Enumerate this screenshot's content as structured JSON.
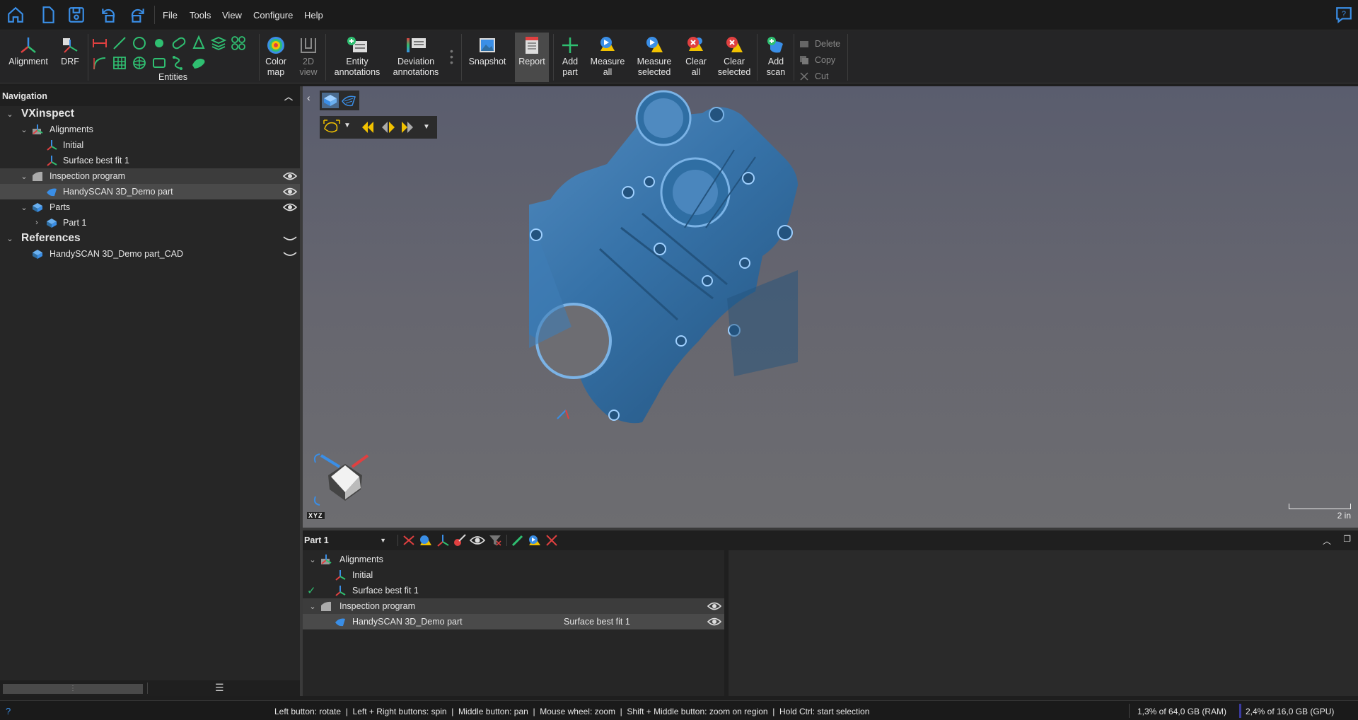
{
  "menubar": {
    "items": [
      "File",
      "Tools",
      "View",
      "Configure",
      "Help"
    ]
  },
  "ribbon": {
    "alignment": "Alignment",
    "drf": "DRF",
    "entities": "Entities",
    "color_map": [
      "Color",
      "map"
    ],
    "view_2d": [
      "2D",
      "view"
    ],
    "entity_annotations": [
      "Entity",
      "annotations"
    ],
    "deviation_annotations": [
      "Deviation",
      "annotations"
    ],
    "snapshot": "Snapshot",
    "report": "Report",
    "add_part": [
      "Add",
      "part"
    ],
    "measure_all": [
      "Measure",
      "all"
    ],
    "measure_selected": [
      "Measure",
      "selected"
    ],
    "clear_all": [
      "Clear",
      "all"
    ],
    "clear_selected": [
      "Clear",
      "selected"
    ],
    "add_scan": [
      "Add",
      "scan"
    ],
    "delete": "Delete",
    "copy": "Copy",
    "cut": "Cut"
  },
  "nav": {
    "title": "Navigation",
    "root": "VXinspect",
    "alignments": "Alignments",
    "initial": "Initial",
    "surface_best_fit": "Surface best fit 1",
    "inspection_program": "Inspection program",
    "demo_part": "HandySCAN 3D_Demo part",
    "parts": "Parts",
    "part1": "Part 1",
    "references": "References",
    "cad": "HandySCAN 3D_Demo part_CAD"
  },
  "viewport": {
    "scale_label": "2 in",
    "axes_label": "XYZ"
  },
  "bottom": {
    "part_select": "Part 1",
    "alignments": "Alignments",
    "initial": "Initial",
    "surface_best_fit": "Surface best fit 1",
    "inspection_program": "Inspection program",
    "demo_part": "HandySCAN 3D_Demo part",
    "demo_part_alignment": "Surface best fit 1"
  },
  "status": {
    "help": "?",
    "hint": "Left button: rotate  |  Left + Right buttons: spin  |  Middle button: pan  |  Mouse wheel: zoom  |  Shift + Middle button: zoom on region  |  Hold Ctrl: start selection",
    "ram": "1,3% of 64,0 GB (RAM)",
    "gpu": "2,4% of 16,0 GB (GPU)"
  },
  "colors": {
    "accent": "#3a8ee6",
    "entity_green": "#2fbf71",
    "part_blue": "#2f6ea3"
  }
}
